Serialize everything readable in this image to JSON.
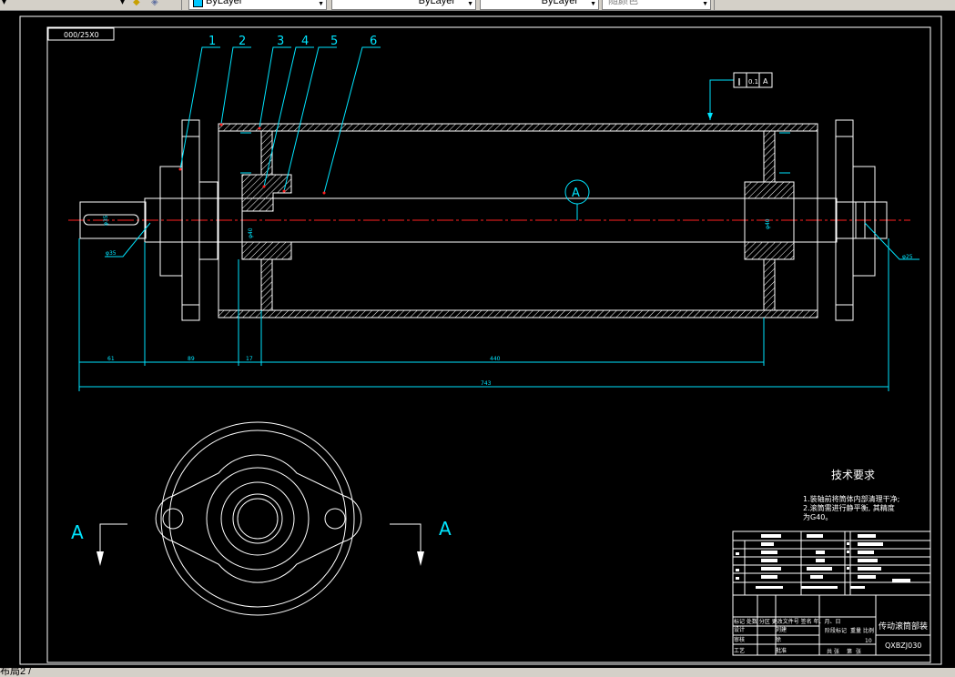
{
  "toolbar": {
    "layer_combo_value": "ByLayer",
    "linetype_combo_value": "ByLayer",
    "lineweight_combo_value": "ByLayer",
    "plotstyle_combo_value": "随颜色"
  },
  "layout_tab": {
    "label": "布局2"
  },
  "drawing": {
    "viewport_label": "000/25X0",
    "balloons": [
      "1",
      "2",
      "3",
      "4",
      "5",
      "6"
    ],
    "section_marker": "A",
    "tolerance_frame": [
      "∥",
      "0.1",
      "A"
    ],
    "dims": {
      "d1": "61",
      "d2": "89",
      "d3": "17",
      "d4": "440",
      "overall": "743",
      "left_shaft_dia": "φ35",
      "left_seat_dia": "φ35",
      "bearing_dia": "φ40",
      "right_bearing_dia": "φ40",
      "right_shaft_dia": "φ25"
    },
    "section_view_label": "A",
    "tech_req_title": "技术要求",
    "tech_req_lines": [
      "1.装轴前将筒体内部清理干净;",
      "2.滚筒需进行静平衡, 其精度",
      "为G40。"
    ],
    "title_block": {
      "title": "传动滚筒部装",
      "code": "QXBZJ030",
      "scale_value": "10",
      "row_labels": [
        "标记 处数 分区 更改文件号 签名 年、月、日",
        "设计",
        "审核",
        "工艺"
      ],
      "small_labels": [
        "阶段标记",
        "重量",
        "比例",
        "共",
        "张",
        "第",
        "张"
      ],
      "name_values": [
        "刘建",
        "徐",
        "批准"
      ]
    }
  },
  "colors": {
    "outline": "#ffffff",
    "dimension": "#00e5ff",
    "centerline": "#ff2020",
    "hatch": "#ffffff",
    "accent_yellow": "#ffff00"
  }
}
